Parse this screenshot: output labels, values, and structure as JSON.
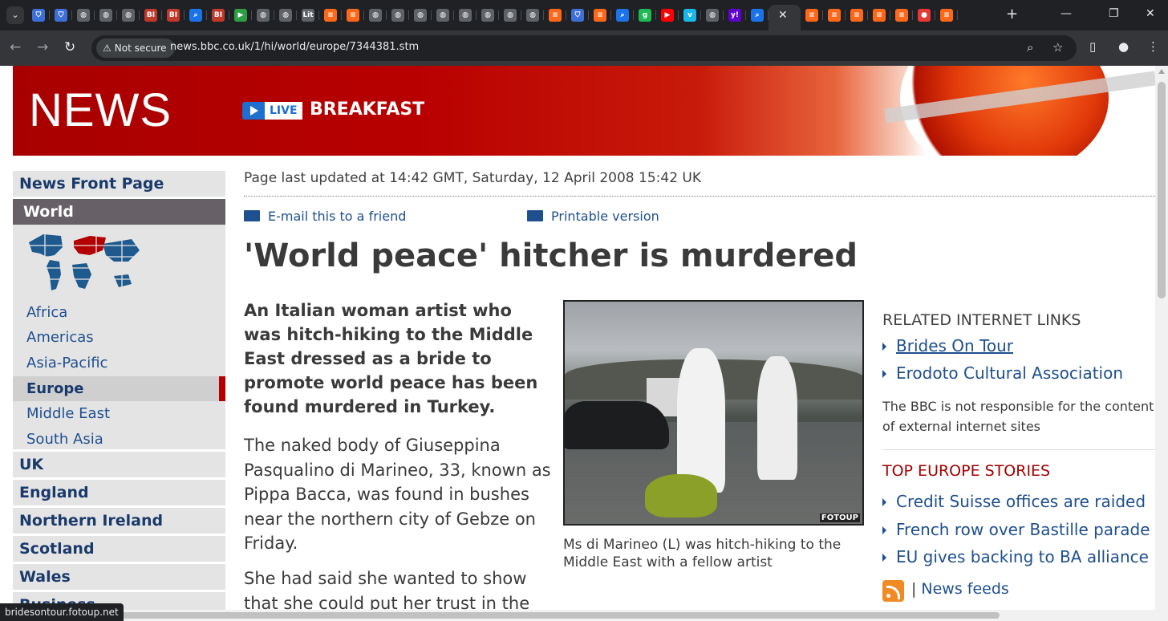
{
  "browser": {
    "tabs": [
      {
        "icon": "shield-icon",
        "color": "#3c6fd8",
        "glyph": "⛉"
      },
      {
        "icon": "shield-icon",
        "color": "#3c6fd8",
        "glyph": "⛉"
      },
      {
        "icon": "globe-icon",
        "color": "#5f6368",
        "glyph": "◍"
      },
      {
        "icon": "globe-icon",
        "color": "#5f6368",
        "glyph": "◍"
      },
      {
        "icon": "globe-icon",
        "color": "#5f6368",
        "glyph": "◍"
      },
      {
        "icon": "bi-icon",
        "color": "#c0392b",
        "glyph": "BI"
      },
      {
        "icon": "bi-icon",
        "color": "#c0392b",
        "glyph": "BI"
      },
      {
        "icon": "search-icon",
        "color": "#1a73e8",
        "glyph": "⌕"
      },
      {
        "icon": "bi-icon",
        "color": "#c0392b",
        "glyph": "BI"
      },
      {
        "icon": "play-icon",
        "color": "#2e9e44",
        "glyph": "▶"
      },
      {
        "icon": "globe-icon",
        "color": "#5f6368",
        "glyph": "◍"
      },
      {
        "icon": "globe-icon",
        "color": "#5f6368",
        "glyph": "◍"
      },
      {
        "icon": "lit-icon",
        "color": "#5f6368",
        "glyph": "Lit"
      },
      {
        "icon": "substack-icon",
        "color": "#ff6719",
        "glyph": "≡"
      },
      {
        "icon": "substack-icon",
        "color": "#ff6719",
        "glyph": "≡"
      },
      {
        "icon": "globe-icon",
        "color": "#5f6368",
        "glyph": "◍"
      },
      {
        "icon": "globe-icon",
        "color": "#5f6368",
        "glyph": "◍"
      },
      {
        "icon": "globe-icon",
        "color": "#5f6368",
        "glyph": "◍"
      },
      {
        "icon": "globe-icon",
        "color": "#5f6368",
        "glyph": "◍"
      },
      {
        "icon": "globe-icon",
        "color": "#5f6368",
        "glyph": "◍"
      },
      {
        "icon": "globe-icon",
        "color": "#5f6368",
        "glyph": "◍"
      },
      {
        "icon": "globe-icon",
        "color": "#5f6368",
        "glyph": "◍"
      },
      {
        "icon": "globe-icon",
        "color": "#5f6368",
        "glyph": "◍"
      },
      {
        "icon": "substack-icon",
        "color": "#ff6719",
        "glyph": "≡"
      },
      {
        "icon": "shield-icon",
        "color": "#3c6fd8",
        "glyph": "⛉"
      },
      {
        "icon": "substack-icon",
        "color": "#ff6719",
        "glyph": "≡"
      },
      {
        "icon": "search-icon",
        "color": "#1a73e8",
        "glyph": "⌕"
      },
      {
        "icon": "g-icon",
        "color": "#1db954",
        "glyph": "g"
      },
      {
        "icon": "youtube-icon",
        "color": "#ff0000",
        "glyph": "▶"
      },
      {
        "icon": "vimeo-icon",
        "color": "#1ab7ea",
        "glyph": "v"
      },
      {
        "icon": "globe-icon",
        "color": "#5f6368",
        "glyph": "◍"
      },
      {
        "icon": "yahoo-icon",
        "color": "#6001d2",
        "glyph": "y!"
      },
      {
        "icon": "search-icon",
        "color": "#1a73e8",
        "glyph": "⌕"
      }
    ],
    "after_tabs": [
      {
        "icon": "substack-icon",
        "color": "#ff6719",
        "glyph": "≡"
      },
      {
        "icon": "substack-icon",
        "color": "#ff6719",
        "glyph": "≡"
      },
      {
        "icon": "substack-icon",
        "color": "#ff6719",
        "glyph": "≡"
      },
      {
        "icon": "substack-icon",
        "color": "#ff6719",
        "glyph": "≡"
      },
      {
        "icon": "substack-icon",
        "color": "#ff6719",
        "glyph": "≡"
      },
      {
        "icon": "mic-icon",
        "color": "#e53935",
        "glyph": "●"
      },
      {
        "icon": "substack-icon",
        "color": "#ff6719",
        "glyph": "≡"
      }
    ],
    "not_secure": "Not secure",
    "url": "news.bbc.co.uk/1/hi/world/europe/7344381.stm",
    "status_url": "bridesontour.fotoup.net"
  },
  "banner": {
    "logo": "NEWS",
    "live": "LIVE",
    "programme": "BREAKFAST"
  },
  "nav": {
    "front": "News Front Page",
    "world": "World",
    "world_sub": [
      "Africa",
      "Americas",
      "Asia-Pacific",
      "Europe",
      "Middle East",
      "South Asia"
    ],
    "selected": "Europe",
    "main": [
      "UK",
      "England",
      "Northern Ireland",
      "Scotland",
      "Wales",
      "Business"
    ]
  },
  "article": {
    "updated": "Page last updated at 14:42 GMT, Saturday, 12 April 2008 15:42 UK",
    "email": "E-mail this to a friend",
    "print": "Printable version",
    "headline": "'World peace' hitcher is murdered",
    "lead": "An Italian woman artist who was hitch-hiking to the Middle East dressed as a bride to promote world peace has been found murdered in Turkey.",
    "para1": "The naked body of Giuseppina Pasqualino di Marineo, 33, known as Pippa Bacca, was found in bushes near the northern city of Gebze on Friday.",
    "para2": "She had said she wanted to show that she could put her trust in the kindness of local people.",
    "photo_credit": "FOTOUP",
    "caption": "Ms di Marineo (L) was hitch-hiking to the Middle East with a fellow artist"
  },
  "related": {
    "heading": "RELATED INTERNET LINKS",
    "links": [
      "Brides On Tour",
      "Erodoto Cultural Association"
    ],
    "disclaimer": "The BBC is not responsible for the content of external internet sites"
  },
  "top_stories": {
    "heading": "TOP EUROPE STORIES",
    "links": [
      "Credit Suisse offices are raided",
      "French row over Bastille parade",
      "EU gives backing to BA alliance"
    ],
    "feeds_sep": "|",
    "feeds": "News feeds"
  }
}
